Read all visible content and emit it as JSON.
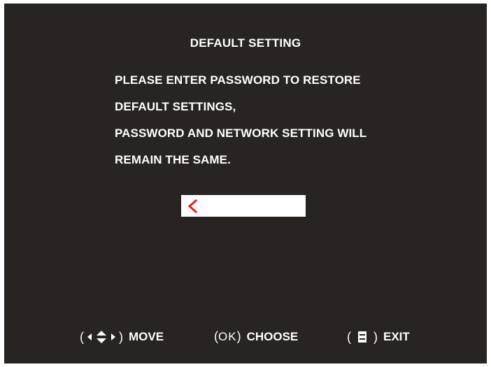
{
  "dialog": {
    "title": "DEFAULT SETTING",
    "message_lines": [
      "PLEASE ENTER PASSWORD TO RESTORE",
      "DEFAULT SETTINGS,",
      "PASSWORD AND NETWORK SETTING WILL",
      "REMAIN THE SAME."
    ],
    "password_value": ""
  },
  "footer": {
    "move": {
      "open": "(",
      "close": ")",
      "label": "MOVE",
      "icon": "arrow-keys-icon"
    },
    "choose": {
      "open": "(",
      "key": "OK",
      "close": ")",
      "label": "CHOOSE"
    },
    "exit": {
      "open": "(",
      "close": ")",
      "label": "EXIT",
      "icon": "menu-key-icon"
    }
  },
  "colors": {
    "background": "#272421",
    "text": "#ffffff",
    "cursor": "#e0202a",
    "input_bg": "#ffffff"
  }
}
